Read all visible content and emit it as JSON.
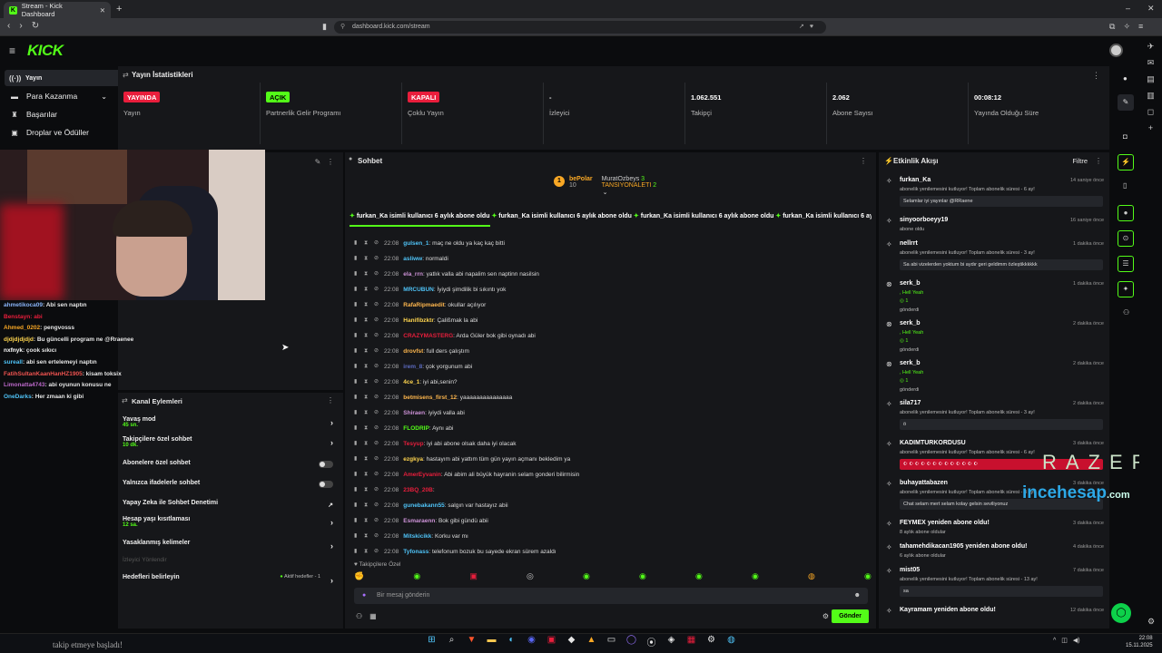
{
  "browser": {
    "tab_title": "Stream - Kick Dashboard",
    "url": "dashboard.kick.com/stream"
  },
  "app": {
    "logo": "KICK",
    "sidebar": [
      {
        "label": "Yayın",
        "icon": "broadcast-icon",
        "active": true
      },
      {
        "label": "Para Kazanma",
        "icon": "money-icon",
        "chevron": true
      },
      {
        "label": "Başarılar",
        "icon": "trophy-icon"
      },
      {
        "label": "Droplar ve Ödüller",
        "icon": "gift-icon"
      }
    ]
  },
  "stats": {
    "title": "Yayın İstatistikleri",
    "items": [
      {
        "value": "YAYINDA",
        "label": "Yayın",
        "color": "#e91e3c"
      },
      {
        "value": "AÇIK",
        "label": "Partnerlik Gelir Programı",
        "color": "#53fc18"
      },
      {
        "value": "KAPALI",
        "label": "Çoklu Yayın",
        "color": "#e91e3c"
      },
      {
        "value": "-",
        "label": "İzleyici"
      },
      {
        "value": "1.062.551",
        "label": "Takipçi"
      },
      {
        "value": "2.062",
        "label": "Abone Sayısı"
      },
      {
        "value": "00:08:12",
        "label": "Yayında Olduğu Süre"
      }
    ]
  },
  "overlay_chat": [
    {
      "user": "ahmetikoca09",
      "text": ": Abi sen naptın",
      "color": "#8ab4f8"
    },
    {
      "user": "Benstayn",
      "text": ": abi",
      "color": "#e91e3c"
    },
    {
      "user": "Ahmed_0202",
      "text": ": pengvosss",
      "color": "#f9a825"
    },
    {
      "user": "djdjdjdjdjd",
      "text": ": Bu güncelli program ne @Rraenee",
      "color": "#ffd54f"
    },
    {
      "user": "nxfnyk",
      "text": ": çook sıkıcı",
      "color": "#ffffff"
    },
    {
      "user": "sureall",
      "text": ": abi sen ertelemeyi naptın",
      "color": "#4fc3f7"
    },
    {
      "user": "FatihSultanKaanHanHZ1905",
      "text": ": kisam toksix",
      "color": "#ef5350"
    },
    {
      "user": "Limonatta4743",
      "text": ": abi oyunun konusu ne",
      "color": "#ba68c8"
    },
    {
      "user": "OneDarks",
      "text": ": Her zmaan ki gibi",
      "color": "#4fc3f7"
    }
  ],
  "channel_actions": {
    "title": "Kanal Eylemleri",
    "items": [
      {
        "label": "Yavaş mod",
        "sub": "45 sn.",
        "type": "arrow"
      },
      {
        "label": "Takipçilere özel sohbet",
        "sub": "10 dk.",
        "type": "arrow"
      },
      {
        "label": "Abonelere özel sohbet",
        "sub": "",
        "type": "toggle"
      },
      {
        "label": "Yalnızca ifadelerle sohbet",
        "sub": "",
        "type": "toggle"
      },
      {
        "label": "Yapay Zeka ile Sohbet Denetimi",
        "sub": "",
        "type": "external"
      },
      {
        "label": "Hesap yaşı kısıtlaması",
        "sub": "12 sa.",
        "type": "arrow"
      },
      {
        "label": "Yasaklanmış kelimeler",
        "sub": "",
        "type": "arrow"
      },
      {
        "label": "İzleyici Yönlendir",
        "sub": "",
        "type": "disabled"
      },
      {
        "label": "Hedefleri belirleyin",
        "sub": "",
        "type": "goal",
        "extra": "Aktif hedefler - 1"
      }
    ]
  },
  "chat": {
    "title": "Sohbet",
    "pinned": {
      "rank": "1",
      "top_user": "bePolar",
      "top_count": "10",
      "u2": "MuratOzbeys",
      "c2": "3",
      "u3": "TANSIYONALETI",
      "c3": "2"
    },
    "ticker": "furkan_Ka isimli kullanıcı 6 aylık abone oldu",
    "messages": [
      {
        "time": "22:08",
        "user": "gulsen_1",
        "text": ": maç ne oldu ya kaç kaç bitti",
        "color": "#4fc3f7"
      },
      {
        "time": "22:08",
        "user": "asliww",
        "text": ": normaldi",
        "color": "#4fc3f7"
      },
      {
        "time": "22:08",
        "user": "ela_rrn",
        "text": ": yatlık valla abi napalim sen naptinn nasilsin",
        "color": "#ce93d8"
      },
      {
        "time": "22:08",
        "user": "MRCUBUN",
        "text": ": İyiydi şimdilik bi sıkıntı yok",
        "color": "#4fc3f7"
      },
      {
        "time": "22:08",
        "user": "RafaRipmaedit",
        "text": ": okullar açılıyor",
        "color": "#ffb74d"
      },
      {
        "time": "22:08",
        "user": "Hanifibzktr",
        "text": ": Çalißmak la abi",
        "color": "#ffd54f"
      },
      {
        "time": "22:08",
        "user": "CRAZYMASTERG",
        "text": ": Arda Güler bok gibi oynadı abi",
        "color": "#e91e3c"
      },
      {
        "time": "22:08",
        "user": "drovfst",
        "text": ": full ders çalıştım",
        "color": "#ffb74d"
      },
      {
        "time": "22:08",
        "user": "irem_8",
        "text": ": çok yorgunum abi",
        "color": "#5c6bc0"
      },
      {
        "time": "22:08",
        "user": "4ce_1",
        "text": ": iyi abi,senin?",
        "color": "#ffd54f"
      },
      {
        "time": "22:08",
        "user": "betmisens_first_12",
        "text": ": yaaaaaaaaaaaaaaa",
        "color": "#ffb74d"
      },
      {
        "time": "22:08",
        "user": "Shiraen",
        "text": ": iyiydi valla abi",
        "color": "#ce93d8"
      },
      {
        "time": "22:08",
        "user": "FLODRIP",
        "text": ": Aynı abi",
        "color": "#53fc18"
      },
      {
        "time": "22:08",
        "user": "Tesyup",
        "text": ": iyi abi abone olsak daha iyi olacak",
        "color": "#e91e3c"
      },
      {
        "time": "22:08",
        "user": "ezgkya",
        "text": ": hastayım abi yattım tüm gün yayın açmanı bekledim ya",
        "color": "#ffd54f"
      },
      {
        "time": "22:08",
        "user": "AmerEyvanin",
        "text": ": Abi abim ali büyük hayranin selam gonderi bilirmisin",
        "color": "#e91e3c"
      },
      {
        "time": "22:08",
        "user": "23BQ_20B",
        "text": ": ",
        "color": "#e91e3c"
      },
      {
        "time": "22:08",
        "user": "gunebakann55",
        "text": ": salgın var hastayız abii",
        "color": "#4fc3f7"
      },
      {
        "time": "22:08",
        "user": "Esmaraenn",
        "text": ": Bok gibi gündü abii",
        "color": "#ce93d8"
      },
      {
        "time": "22:08",
        "user": "Mitskicikk",
        "text": ": Korku var mı",
        "color": "#4fc3f7"
      },
      {
        "time": "22:08",
        "user": "Tyfonass",
        "text": ": telefonum bozuk bu sayede ekran sürem azaldı",
        "color": "#4fc3f7"
      }
    ],
    "followers_only": "Takipçilere Özel",
    "input_placeholder": "Bir mesaj gönderin",
    "send_label": "Gönder"
  },
  "feed": {
    "title": "Etkinlik Akışı",
    "filter": "Filtre",
    "events": [
      {
        "user": "furkan_Ka",
        "time": "14 saniye önce",
        "desc": "abonelik yenilemesini kutluyor! Toplam abonelik süresi - 6 ay!",
        "box": "Selamlar iyi yayınlar @RRaene"
      },
      {
        "user": "sinyoorboeyy19",
        "time": "16 saniye önce",
        "desc": "abone oldu",
        "box": ""
      },
      {
        "user": "nellrrt",
        "time": "1 dakika önce",
        "desc": "abonelik yenilemesini kutluyor! Toplam abonelik süresi - 3 ay!",
        "box": "Sa abi vizelerden yoktum bi aydır geri geldimm özleştikkkkkk"
      },
      {
        "user": "serk_b",
        "time": "1 dakika önce",
        "desc": ", Hell Yeah",
        "box": "",
        "gift": "1",
        "sent": "gönderdi"
      },
      {
        "user": "serk_b",
        "time": "2 dakika önce",
        "desc": ", Hell Yeah",
        "box": "",
        "gift": "1",
        "sent": "gönderdi"
      },
      {
        "user": "serk_b",
        "time": "2 dakika önce",
        "desc": ", Hell Yeah",
        "box": "",
        "gift": "1",
        "sent": "gönderdi"
      },
      {
        "user": "sila717",
        "time": "2 dakika önce",
        "desc": "abonelik yenilemesini kutluyor! Toplam abonelik süresi - 3 ay!",
        "box": "ö"
      },
      {
        "user": "KADIMTURKORDUSU",
        "time": "3 dakika önce",
        "desc": "abonelik yenilemesini kutluyor! Toplam abonelik süresi - 6 ay!",
        "box": "flags"
      },
      {
        "user": "buhayattabazen",
        "time": "3 dakika önce",
        "desc": "abonelik yenilemesini kutluyor! Toplam abonelik süresi - 3 ay!",
        "box": "Chat selam mert selam kolay gelsin seviliyonuz"
      },
      {
        "user": "FEYMEX yeniden abone oldu!",
        "time": "3 dakika önce",
        "desc": "8 aylık abone oldular",
        "box": ""
      },
      {
        "user": "tahamehdikacan1905 yeniden abone oldu!",
        "time": "4 dakika önce",
        "desc": "6 aylık abone oldular",
        "box": ""
      },
      {
        "user": "mist05",
        "time": "7 dakika önce",
        "desc": "abonelik yenilemesini kutluyor! Toplam abonelik süresi - 13 ay!",
        "box": "sa"
      },
      {
        "user": "Kayramam yeniden abone oldu!",
        "time": "12 dakika önce",
        "desc": "",
        "box": ""
      }
    ]
  },
  "watermark": {
    "brand1": "RAZER",
    "brand2a": "ince",
    "brand2b": "hesap",
    "brand2c": ".com"
  },
  "taskbar": {
    "message": "takip etmeye başladı!",
    "time": "22:08",
    "date": "15.11.2025"
  }
}
